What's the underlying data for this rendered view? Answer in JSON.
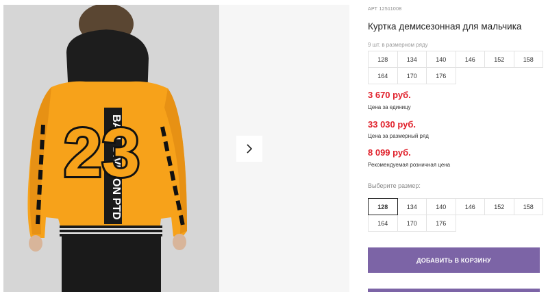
{
  "product": {
    "article": "АРТ 12511008",
    "title": "Куртка демисезонная для мальчика",
    "series_label": "9 шт. в размерном ряду",
    "series_sizes": [
      "128",
      "134",
      "140",
      "146",
      "152",
      "158",
      "164",
      "170",
      "176"
    ],
    "prices": [
      {
        "value": "3 670 руб.",
        "note": "Цена за единицу"
      },
      {
        "value": "33 030 руб.",
        "note": "Цена за размерный ряд"
      },
      {
        "value": "8 099 руб.",
        "note": "Рекомендуемая розничная цена"
      }
    ],
    "size_select_label": "Выберите размер:",
    "sizes": [
      "128",
      "134",
      "140",
      "146",
      "152",
      "158",
      "164",
      "170",
      "176"
    ],
    "selected_size": "128",
    "add_to_cart": "ДОБАВИТЬ В КОРЗИНУ"
  },
  "photo": {
    "back_print_number": "23",
    "back_print_text": "BALL DIVISION PTD"
  },
  "colors": {
    "accent": "#7c64a6",
    "price": "#e0202a",
    "jacket": "#f7a21a"
  },
  "icons": {
    "next": "chevron-right-icon"
  }
}
